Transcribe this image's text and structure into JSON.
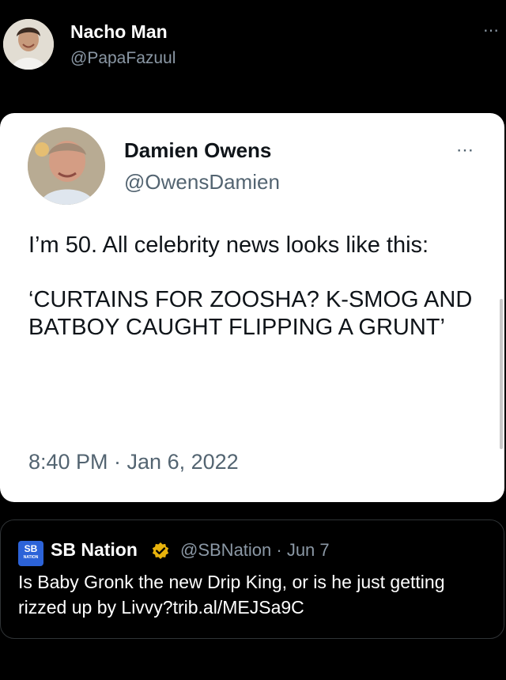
{
  "outer": {
    "name": "Nacho Man",
    "handle": "@PapaFazuul",
    "more_icon": "⋯"
  },
  "card": {
    "name": "Damien Owens",
    "handle": "@OwensDamien",
    "more_icon": "⋯",
    "text_1": "I’m 50. All celebrity news looks like this:",
    "text_2": "‘CURTAINS FOR ZOOSHA? K-SMOG AND BATBOY CAUGHT FLIPPING A GRUNT’",
    "time": "8:40 PM · Jan 6, 2022"
  },
  "quote": {
    "logo_text": "SB",
    "logo_subtext": "NATION",
    "name": "SB Nation",
    "meta": "@SBNation · Jun 7",
    "text": "Is Baby Gronk the new Drip King, or is he just getting rizzed up by Livvy?trib.al/MEJSa9C",
    "verified_color": "#e8b30c"
  }
}
